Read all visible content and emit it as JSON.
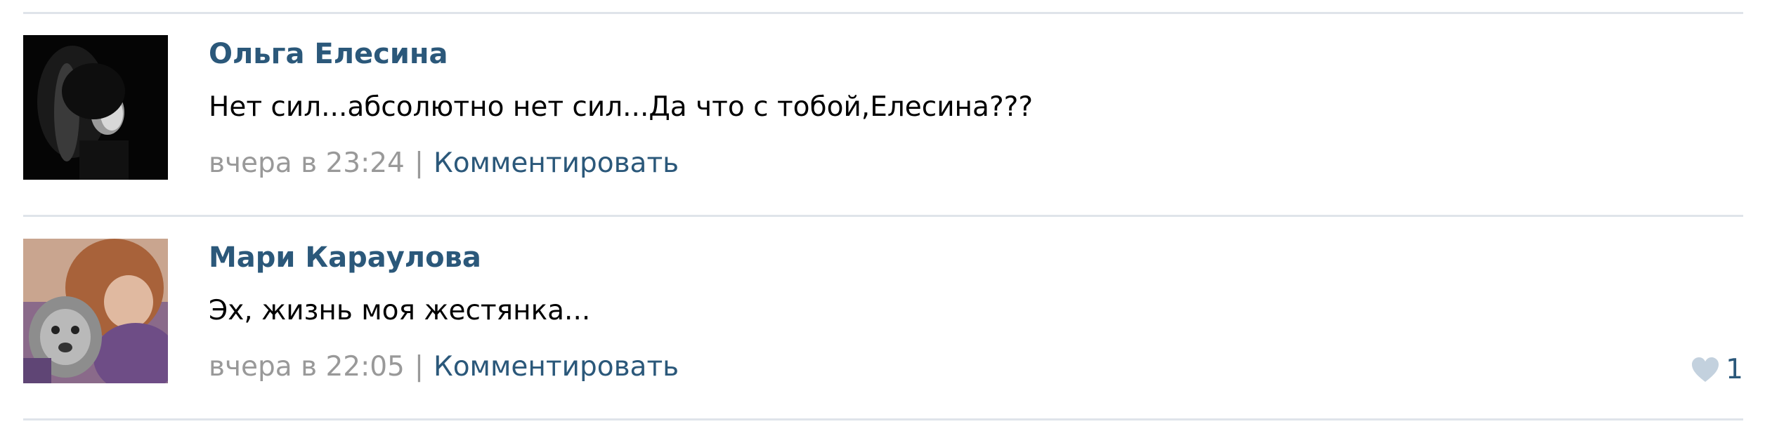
{
  "feed": {
    "posts": [
      {
        "author": "Ольга Елесина",
        "text": "Нет сил...абсолютно нет сил...Да что с тобой,Елесина???",
        "time": "вчера в 23:24",
        "separator": "|",
        "comment_label": "Комментировать",
        "likes": null
      },
      {
        "author": "Мари Караулова",
        "text": "Эх, жизнь моя жестянка...",
        "time": "вчера в 22:05",
        "separator": "|",
        "comment_label": "Комментировать",
        "likes": "1"
      }
    ]
  },
  "icons": {
    "like": "heart-icon"
  },
  "colors": {
    "link": "#2b587a",
    "muted": "#999999",
    "divider": "#dfe4ea",
    "heart": "#c3d1de"
  }
}
